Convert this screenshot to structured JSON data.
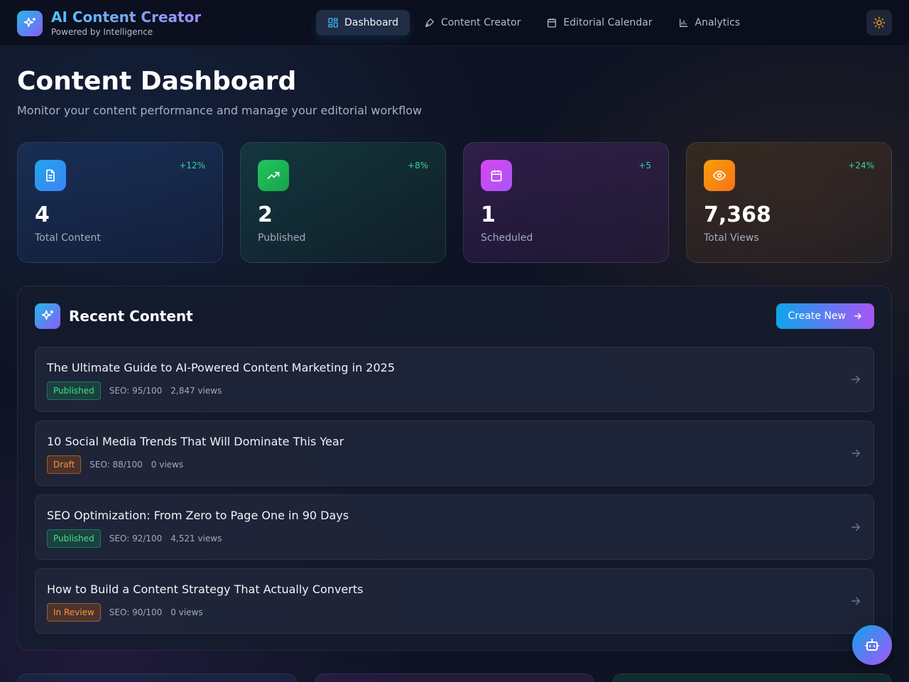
{
  "brand": {
    "title": "AI Content Creator",
    "subtitle": "Powered by Intelligence"
  },
  "nav": [
    {
      "label": "Dashboard",
      "icon": "grid-icon",
      "active": true
    },
    {
      "label": "Content Creator",
      "icon": "pen-icon",
      "active": false
    },
    {
      "label": "Editorial Calendar",
      "icon": "calendar-icon",
      "active": false
    },
    {
      "label": "Analytics",
      "icon": "bar-chart-icon",
      "active": false
    }
  ],
  "header": {
    "theme_icon": "sun-icon"
  },
  "page": {
    "title": "Content Dashboard",
    "subtitle": "Monitor your content performance and manage your editorial workflow"
  },
  "stats": [
    {
      "value": "4",
      "label": "Total Content",
      "change": "+12%",
      "icon": "document-icon",
      "color": "#2f9be8"
    },
    {
      "value": "2",
      "label": "Published",
      "change": "+8%",
      "icon": "trending-up-icon",
      "color": "#22c55e"
    },
    {
      "value": "1",
      "label": "Scheduled",
      "change": "+5",
      "icon": "calendar-icon",
      "color": "#c044e6"
    },
    {
      "value": "7,368",
      "label": "Total Views",
      "change": "+24%",
      "icon": "eye-icon",
      "color": "#f59e0b"
    }
  ],
  "recent": {
    "title": "Recent Content",
    "create_label": "Create New",
    "items": [
      {
        "title": "The Ultimate Guide to AI-Powered Content Marketing in 2025",
        "status": "Published",
        "seo": "SEO: 95/100",
        "views": "2,847 views"
      },
      {
        "title": "10 Social Media Trends That Will Dominate This Year",
        "status": "Draft",
        "seo": "SEO: 88/100",
        "views": "0 views"
      },
      {
        "title": "SEO Optimization: From Zero to Page One in 90 Days",
        "status": "Published",
        "seo": "SEO: 92/100",
        "views": "4,521 views"
      },
      {
        "title": "How to Build a Content Strategy That Actually Converts",
        "status": "In Review",
        "seo": "SEO: 90/100",
        "views": "0 views"
      }
    ]
  },
  "colors": {
    "accent_start": "#0ea5e9",
    "accent_end": "#a855f7",
    "positive": "#34d399",
    "background": "#0f1424"
  }
}
